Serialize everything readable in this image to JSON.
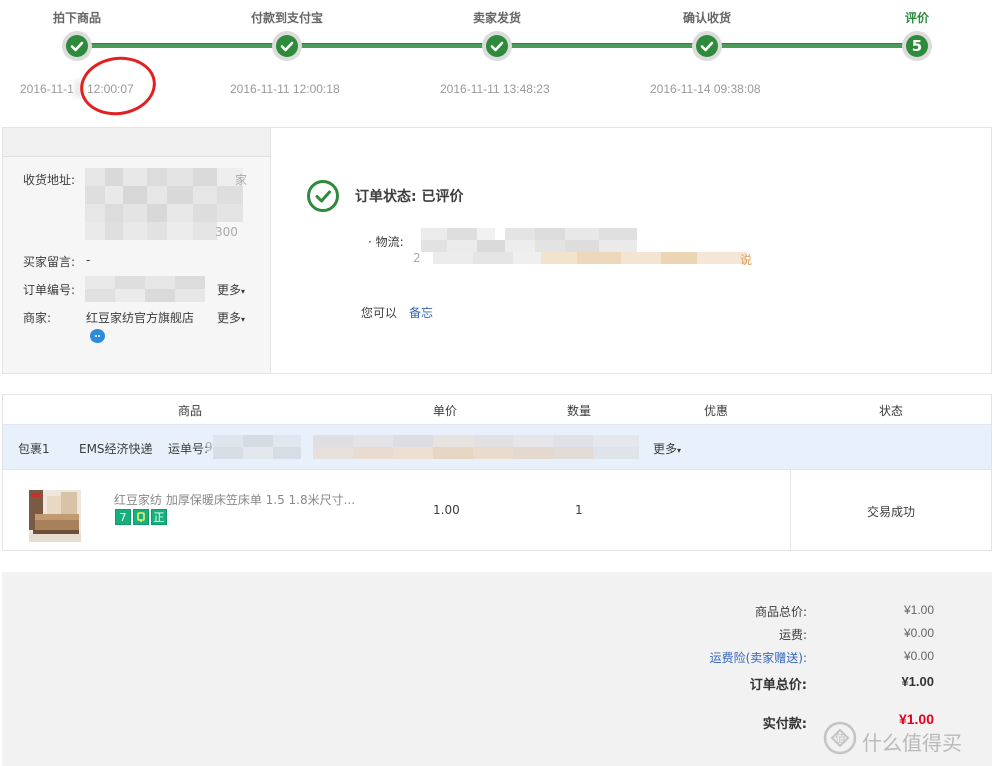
{
  "progress": {
    "steps": [
      {
        "label": "拍下商品",
        "time": "2016-11-1"
      },
      {
        "label": "付款到支付宝",
        "time": "2016-11-11 12:00:18"
      },
      {
        "label": "卖家发货",
        "time": "2016-11-11 13:48:23"
      },
      {
        "label": "确认收货",
        "time": "2016-11-14 09:38:08"
      },
      {
        "label": "评价",
        "time": ""
      }
    ],
    "first_time_highlight": "12:00:07",
    "current_step_number": "5",
    "colors": {
      "active": "#2e8b3c",
      "annotation": "#e32020"
    }
  },
  "order_info": {
    "address_label": "收货地址:",
    "address_partial_1": "家",
    "address_partial_2": "300",
    "buyer_message_label": "买家留言:",
    "buyer_message_value": "-",
    "order_number_label": "订单编号:",
    "order_number_more": "更多",
    "seller_label": "商家:",
    "seller_name": "红豆家纺官方旗舰店",
    "seller_more": "更多"
  },
  "order_status": {
    "title": "订单状态: 已评价",
    "logistics_label": "· 物流:",
    "logistics_partial_prefix": "2",
    "logistics_partial_suffix": "说",
    "you_can_label": "您可以",
    "remark_link": "备忘"
  },
  "goods_table": {
    "headers": {
      "product": "商品",
      "unit_price": "单价",
      "quantity": "数量",
      "discount": "优惠",
      "status": "状态"
    },
    "package": {
      "name": "包裹1",
      "carrier": "EMS经济快递",
      "tracking_label": "运单号:",
      "tracking_partial": "9",
      "more": "更多"
    },
    "item": {
      "title": "红豆家纺 加厚保暖床笠床单 1.5 1.8米尺寸...",
      "badges": [
        "7",
        "",
        "正"
      ],
      "unit_price": "1.00",
      "quantity": "1",
      "status": "交易成功"
    }
  },
  "totals": {
    "goods_total_label": "商品总价:",
    "goods_total_value": "¥1.00",
    "shipping_label": "运费:",
    "shipping_value": "¥0.00",
    "insurance_label": "运费险(卖家赠送):",
    "insurance_value": "¥0.00",
    "order_total_label": "订单总价:",
    "order_total_value": "¥1.00",
    "paid_label": "实付款:",
    "paid_value": "¥1.00"
  },
  "watermark": {
    "text": "什么值得买"
  }
}
